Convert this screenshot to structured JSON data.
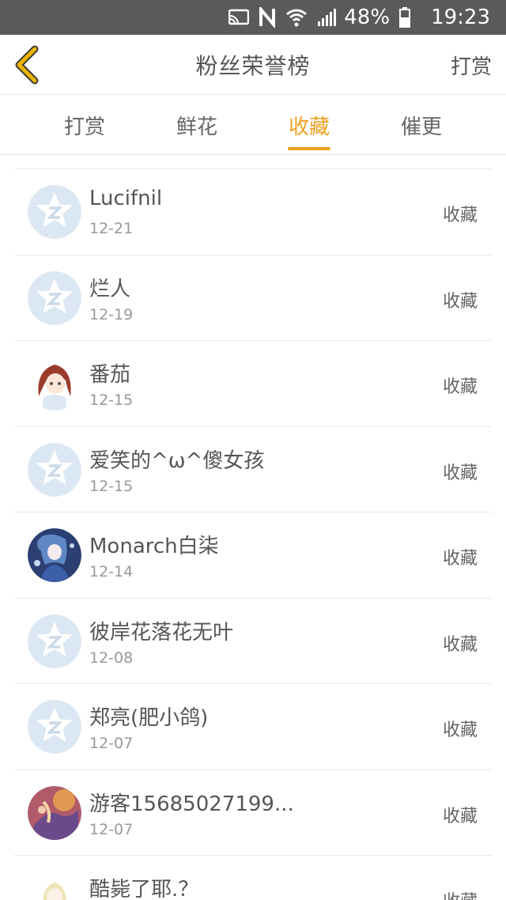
{
  "status_bar": {
    "battery": "48%",
    "time": "19:23",
    "icons": [
      "cast-icon",
      "nfc-icon",
      "wifi-icon",
      "signal-icon",
      "battery-icon"
    ]
  },
  "header": {
    "title": "粉丝荣誉榜",
    "action": "打赏"
  },
  "tabs": [
    "打赏",
    "鲜花",
    "收藏",
    "催更"
  ],
  "active_tab": "收藏",
  "accent_color": "#f0a020",
  "list": [
    {
      "name": "Lucifnil",
      "date": "12-21",
      "action": "收藏",
      "avatar": "default-star-avatar"
    },
    {
      "name": "烂人",
      "date": "12-19",
      "action": "收藏",
      "avatar": "default-star-avatar"
    },
    {
      "name": "番茄",
      "date": "12-15",
      "action": "收藏",
      "avatar": "anime-girl-avatar"
    },
    {
      "name": "爱笑的^ω^傻女孩",
      "date": "12-15",
      "action": "收藏",
      "avatar": "default-star-avatar"
    },
    {
      "name": "Monarch白柒",
      "date": "12-14",
      "action": "收藏",
      "avatar": "blue-anime-avatar"
    },
    {
      "name": "彼岸花落花无叶",
      "date": "12-08",
      "action": "收藏",
      "avatar": "default-star-avatar"
    },
    {
      "name": "郑亮(肥小鸽)",
      "date": "12-07",
      "action": "收藏",
      "avatar": "default-star-avatar"
    },
    {
      "name": "游客15685027199...",
      "date": "12-07",
      "action": "收藏",
      "avatar": "colorful-art-avatar"
    },
    {
      "name": "酷毙了耶.？",
      "date": "",
      "action": "收藏",
      "avatar": "light-anime-avatar"
    }
  ]
}
